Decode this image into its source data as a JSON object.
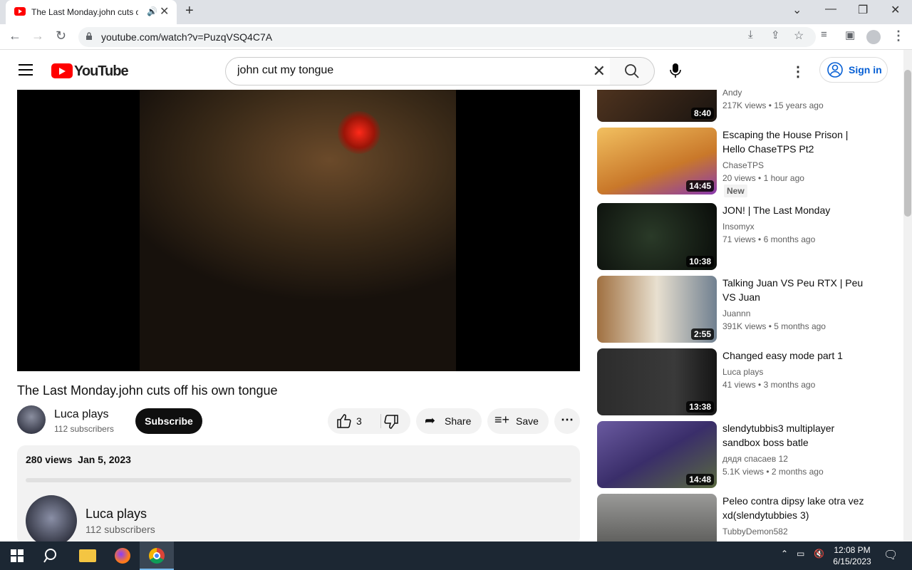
{
  "browser": {
    "tab_title": "The Last Monday.john cuts off his own tongue",
    "new_tab": "+",
    "url": "youtube.com/watch?v=PuzqVSQ4C7A"
  },
  "header": {
    "logo": "YouTube",
    "search_value": "john cut my tongue",
    "sign_in": "Sign in"
  },
  "video": {
    "title": "The Last Monday.john cuts off his own tongue",
    "channel": "Luca plays",
    "subscribers": "112 subscribers",
    "subscribe_label": "Subscribe",
    "likes": "3",
    "share_label": "Share",
    "save_label": "Save",
    "views": "280 views",
    "date": "Jan 5, 2023"
  },
  "recommendations": [
    {
      "title": "",
      "channel": "Andy",
      "views": "217K views",
      "age": "15 years ago",
      "duration": "8:40",
      "thumb": "#3a2a1e"
    },
    {
      "title": "Escaping the House Prison | Hello ChaseTPS Pt2",
      "channel": "ChaseTPS",
      "views": "20 views",
      "age": "1 hour ago",
      "duration": "14:45",
      "badge": "New",
      "thumb": "#e0a040"
    },
    {
      "title": "JON! | The Last Monday",
      "channel": "Insomyx",
      "views": "71 views",
      "age": "6 months ago",
      "duration": "10:38",
      "thumb": "#0e1410"
    },
    {
      "title": "Talking Juan VS Peu RTX | Peu VS Juan",
      "channel": "Juannn",
      "views": "391K views",
      "age": "5 months ago",
      "duration": "2:55",
      "thumb": "#8a6a4a"
    },
    {
      "title": "Changed easy mode part 1",
      "channel": "Luca plays",
      "views": "41 views",
      "age": "3 months ago",
      "duration": "13:38",
      "thumb": "#2a2a2a"
    },
    {
      "title": "slendytubbis3 multiplayer sandbox boss batle",
      "channel": "дядя спасаев 12",
      "views": "5.1K views",
      "age": "2 months ago",
      "duration": "14:48",
      "thumb": "#5a4a8a"
    },
    {
      "title": "Peleo contra dipsy lake otra vez xd(slendytubbies 3)",
      "channel": "TubbyDemon582",
      "views": "",
      "age": "",
      "duration": "",
      "thumb": "#7a7a78"
    }
  ],
  "taskbar": {
    "time": "12:08 PM",
    "date": "6/15/2023"
  }
}
